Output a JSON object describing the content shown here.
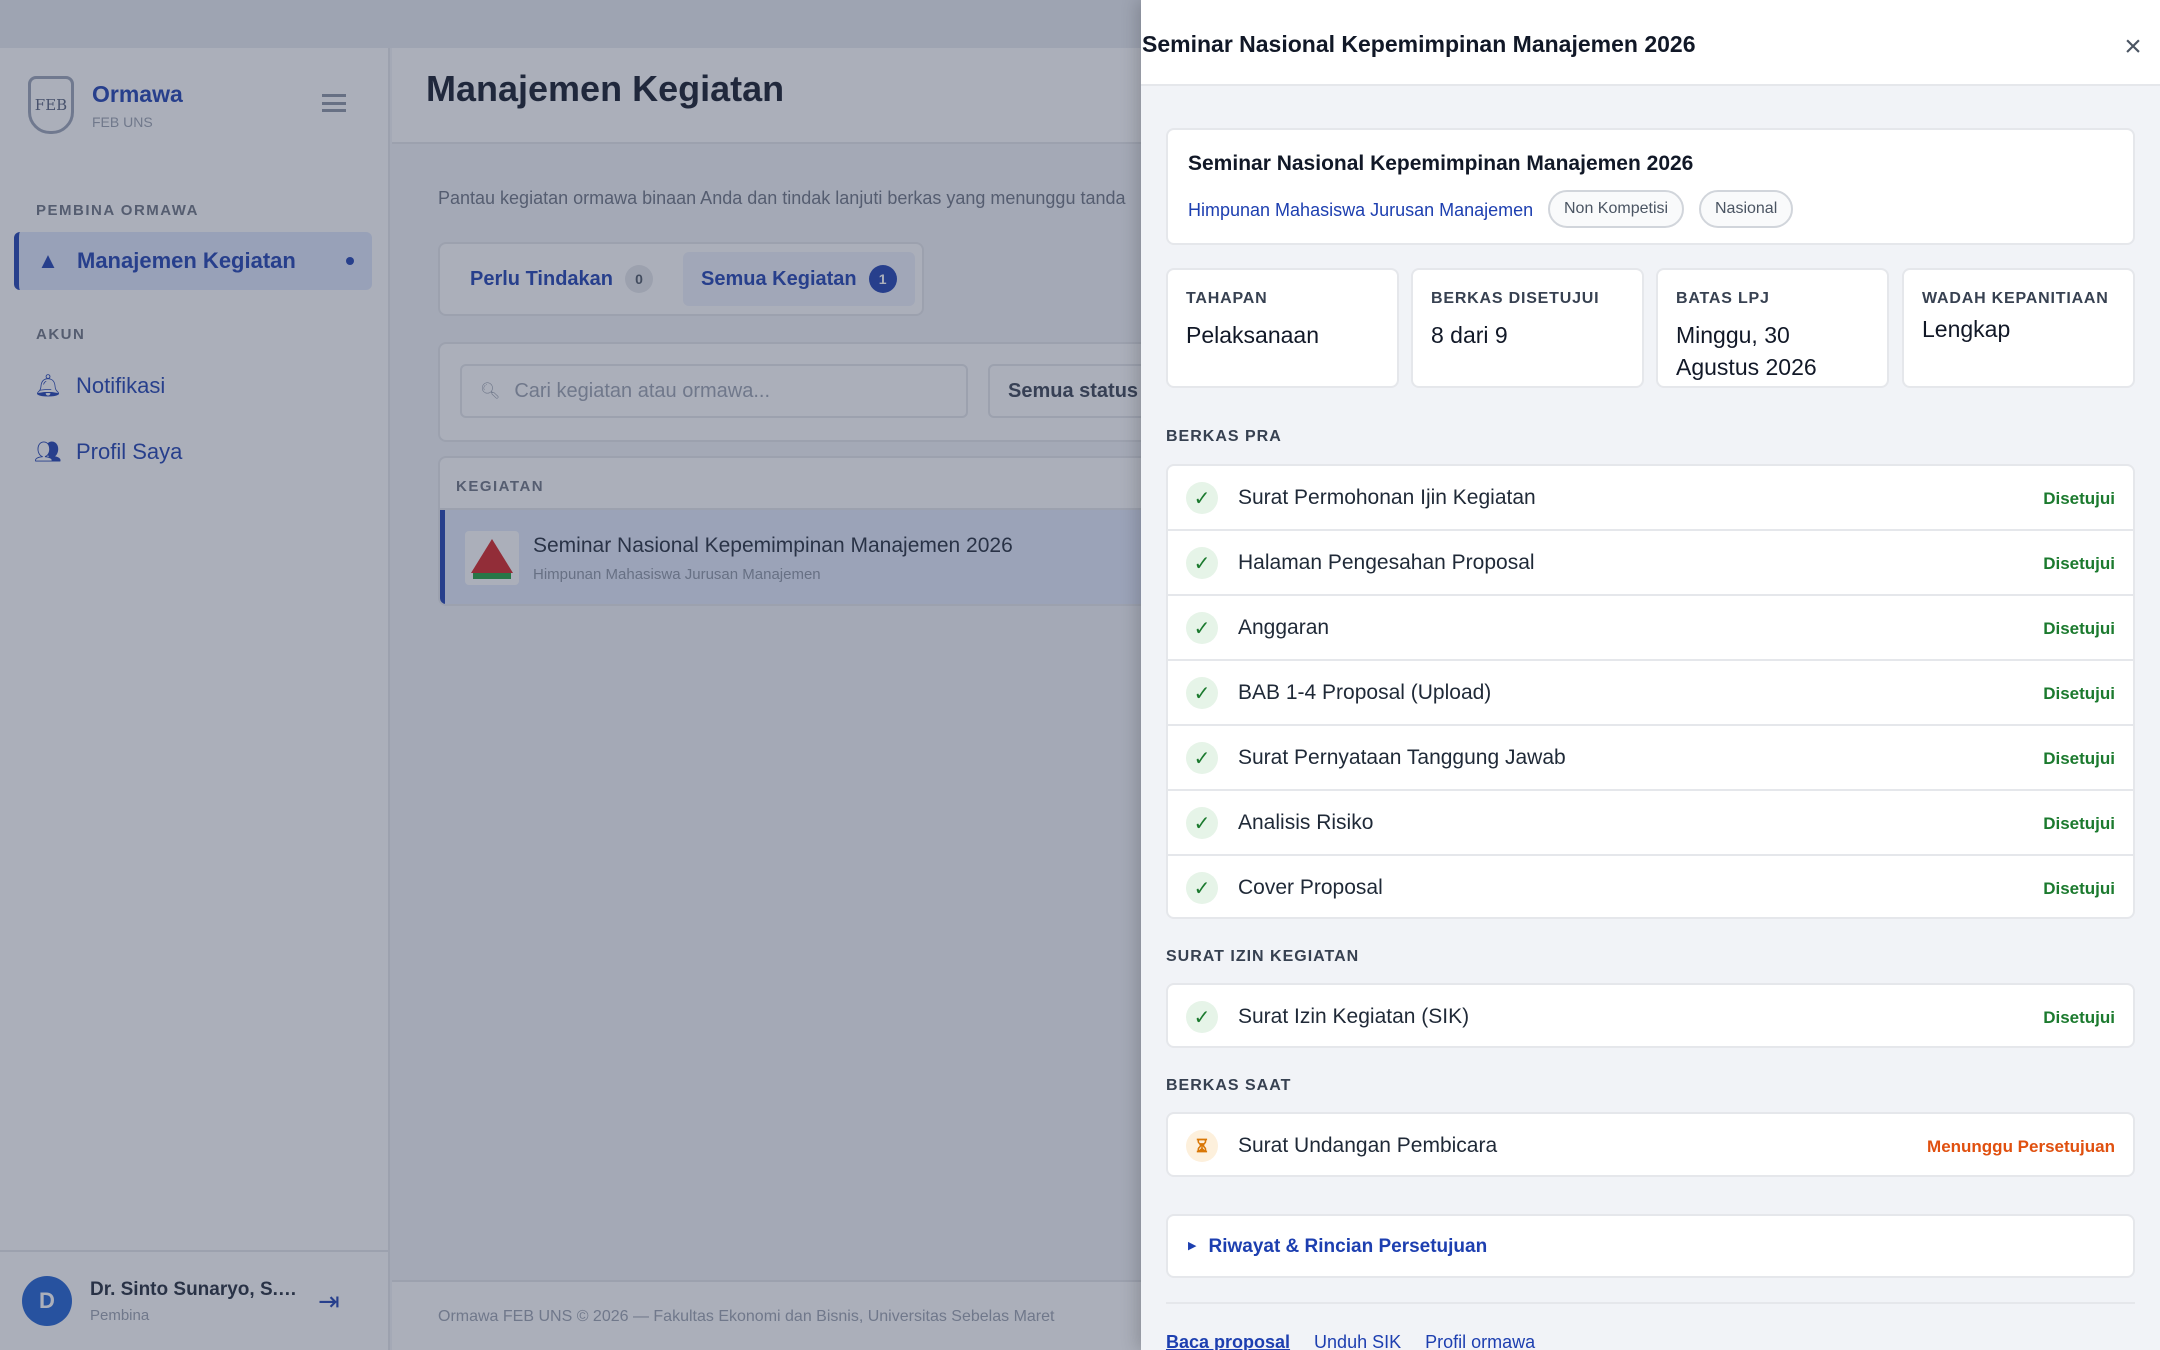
{
  "app": {
    "brand_name": "Ormawa",
    "brand_sub": "FEB UNS",
    "logo_text": "FEB"
  },
  "sidebar": {
    "section_pembina": "PEMBINA ORMAWA",
    "section_akun": "AKUN",
    "items": [
      {
        "label": "Manajemen Kegiatan",
        "icon": "warning-triangle-icon",
        "active": true
      },
      {
        "label": "Notifikasi",
        "icon": "bell-icon"
      },
      {
        "label": "Profil Saya",
        "icon": "users-icon"
      }
    ],
    "user": {
      "initial": "D",
      "name": "Dr. Sinto Sunaryo, S.E.,...",
      "role": "Pembina"
    }
  },
  "main": {
    "title": "Manajemen Kegiatan",
    "description": "Pantau kegiatan ormawa binaan Anda dan tindak lanjuti berkas yang menunggu tanda",
    "tabs": [
      {
        "label": "Perlu Tindakan",
        "count": "0"
      },
      {
        "label": "Semua Kegiatan",
        "count": "1"
      }
    ],
    "search_placeholder": "Cari kegiatan atau ormawa...",
    "status_filter": "Semua status",
    "table_header": "KEGIATAN",
    "row": {
      "title": "Seminar Nasional Kepemimpinan Manajemen 2026",
      "subtitle": "Himpunan Mahasiswa Jurusan Manajemen"
    },
    "footer": "Ormawa FEB UNS © 2026 — Fakultas Ekonomi dan Bisnis, Universitas Sebelas Maret"
  },
  "drawer": {
    "title": "Seminar Nasional Kepemimpinan Manajemen 2026",
    "summary": {
      "title": "Seminar Nasional Kepemimpinan Manajemen 2026",
      "org": "Himpunan Mahasiswa Jurusan Manajemen",
      "tags": [
        "Non Kompetisi",
        "Nasional"
      ]
    },
    "stats": [
      {
        "label": "TAHAPAN",
        "value": "Pelaksanaan"
      },
      {
        "label": "BERKAS DISETUJUI",
        "value": "8 dari 9"
      },
      {
        "label": "BATAS LPJ",
        "value": "Minggu, 30 Agustus 2026"
      },
      {
        "label": "WADAH KEPANITIAAN",
        "value": "Lengkap"
      }
    ],
    "sections": {
      "pra": {
        "label": "BERKAS PRA",
        "docs": [
          {
            "name": "Surat Permohonan Ijin Kegiatan",
            "status": "Disetujui"
          },
          {
            "name": "Halaman Pengesahan Proposal",
            "status": "Disetujui"
          },
          {
            "name": "Anggaran",
            "status": "Disetujui"
          },
          {
            "name": "BAB 1-4 Proposal (Upload)",
            "status": "Disetujui"
          },
          {
            "name": "Surat Pernyataan Tanggung Jawab",
            "status": "Disetujui"
          },
          {
            "name": "Analisis Risiko",
            "status": "Disetujui"
          },
          {
            "name": "Cover Proposal",
            "status": "Disetujui"
          }
        ]
      },
      "sik": {
        "label": "SURAT IZIN KEGIATAN",
        "docs": [
          {
            "name": "Surat Izin Kegiatan (SIK)",
            "status": "Disetujui"
          }
        ]
      },
      "saat": {
        "label": "BERKAS SAAT",
        "docs": [
          {
            "name": "Surat Undangan Pembicara",
            "status": "Menunggu Persetujuan"
          }
        ]
      }
    },
    "history_label": "Riwayat & Rincian Persetujuan",
    "actions": [
      "Baca proposal",
      "Unduh SIK",
      "Profil ormawa"
    ],
    "colors": {
      "approved": "#1b7a2e",
      "pending": "#e0500f",
      "accent": "#1d3fb0"
    }
  }
}
